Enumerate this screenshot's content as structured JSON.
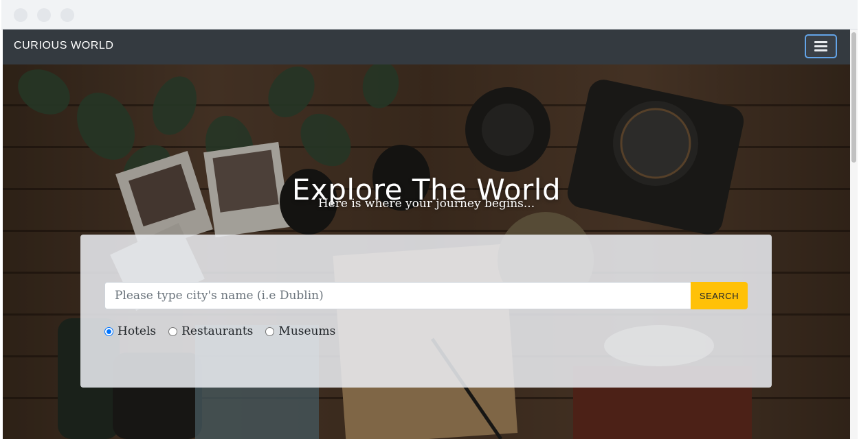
{
  "navbar": {
    "brand": "CURIOUS WORLD",
    "toggler_icon": "hamburger-icon"
  },
  "hero": {
    "title": "Explore The World",
    "subtitle": "Here is where your journey begins..."
  },
  "search": {
    "placeholder": "Please type city's name (i.e Dublin)",
    "value": "",
    "button_label": "SEARCH",
    "options": [
      {
        "label": "Hotels",
        "checked": true
      },
      {
        "label": "Restaurants",
        "checked": false
      },
      {
        "label": "Museums",
        "checked": false
      }
    ]
  },
  "colors": {
    "navbar_bg": "#343a40",
    "search_button": "#ffc107",
    "radio_accent": "#0075ff",
    "toggler_border": "#63a4e8"
  }
}
